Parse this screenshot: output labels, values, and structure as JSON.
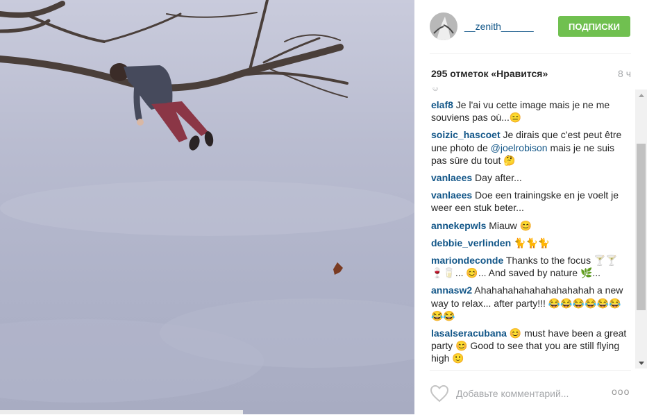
{
  "post": {
    "username": "__zenith______",
    "follow_label": "ПОДПИСКИ",
    "likes": "295 отметок «Нравится»",
    "time_ago": "8 ч",
    "comment_placeholder": "Добавьте комментарий...",
    "more_label": "ooo"
  },
  "comments": [
    {
      "author": "elaf8",
      "text": " Je l'ai vu cette image mais je ne me souviens pas où...😑"
    },
    {
      "author": "soizic_hascoet",
      "text_before": " Je dirais que c'est peut être une photo de ",
      "mention": "@joelrobison",
      "text_after": " mais je ne suis pas sûre du tout 🤔"
    },
    {
      "author": "vanlaees",
      "text": " Day after..."
    },
    {
      "author": "vanlaees",
      "text": " Doe een trainingske en je voelt je weer een stuk beter..."
    },
    {
      "author": "annekepwls",
      "text": " Miauw 😊"
    },
    {
      "author": "debbie_verlinden",
      "text": " 🐈🐈🐈"
    },
    {
      "author": "mariondeconde",
      "text": " Thanks to the focus 🍸🍸🍷🥛... 😊... And saved by nature 🌿..."
    },
    {
      "author": "annasw2",
      "text": " Ahahahahahahahahahahah a new way to relax... after party!!! 😂😂😂😂😂😂😂😂"
    },
    {
      "author": "lasalseracubana",
      "text": " 😊 must have been a great party 😊 Good to see that you are still flying high 🙂"
    }
  ],
  "colors": {
    "accent": "#70c050",
    "link": "#125688",
    "muted": "#a5a7aa"
  },
  "icons": {
    "heart": "heart-icon",
    "more": "more-options-icon",
    "scroll_up": "chevron-up-icon",
    "scroll_down": "chevron-down-icon"
  }
}
